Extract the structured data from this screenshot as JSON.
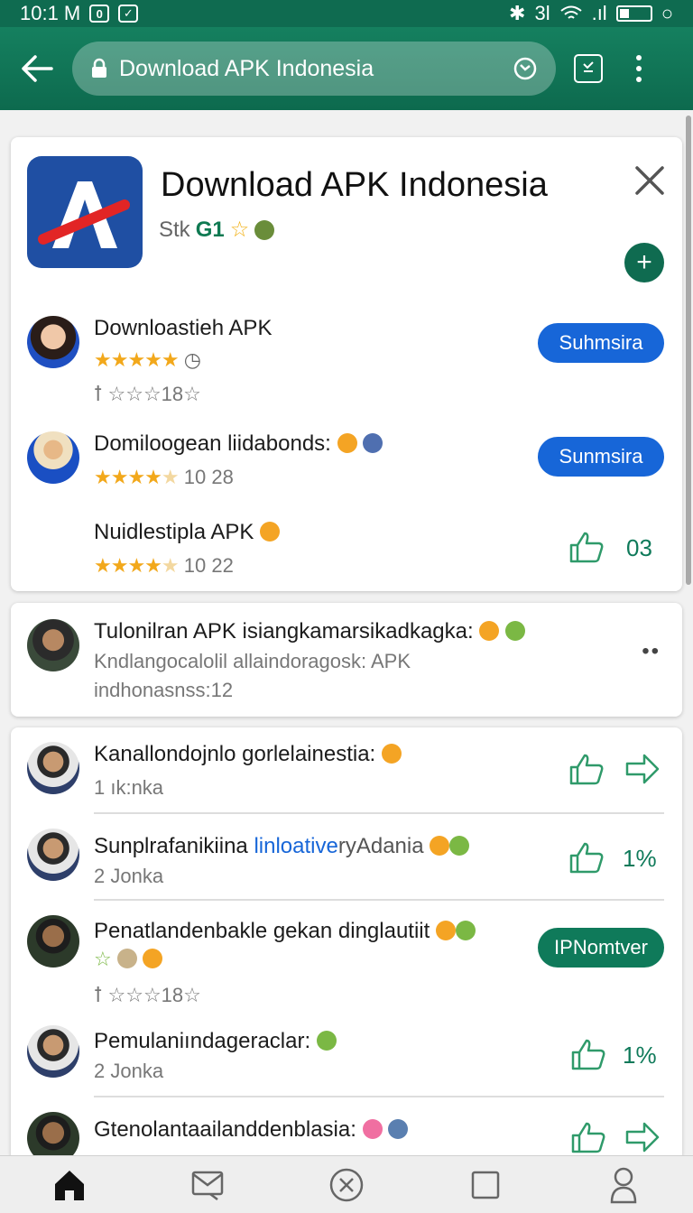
{
  "status_bar": {
    "time": "10:1 M",
    "signal_text": "3l"
  },
  "url_bar": {
    "url_text": "Download APK Indonesia"
  },
  "app_card": {
    "title": "Download APK Indonesia",
    "subtitle_a": "Stk",
    "subtitle_b": "G1",
    "items": [
      {
        "title": "Downloastieh APK",
        "stars": "★★★★★",
        "sub": "ꝉ ☆☆☆18☆",
        "button": "Suhmsira"
      },
      {
        "title": "Domiloogean liidabonds:",
        "stars": "★★★★",
        "rating": "10 28",
        "button": "Sunmsira"
      },
      {
        "title": "Nuidlestipla APK",
        "stars": "★★★★",
        "rating": "10 22",
        "metric": "03"
      }
    ]
  },
  "featured_post": {
    "title": "Tulonilran APK isiangkamarsikadkagka:",
    "line2": "Kndlangocalolil allaindoragosk: APK",
    "line3": "indhonasnss:12",
    "more": "••"
  },
  "feed": [
    {
      "title": "Kanallondojnlo gorlelainestia:",
      "sub": "1 ık:nka"
    },
    {
      "title_a": "Sunplrafanikiina ",
      "title_link": "linloative",
      "title_b": "ryAdania",
      "sub": "2 Jonka",
      "metric": "1%"
    },
    {
      "title": "Penatlandenbakle gekan dinglautiit",
      "sub": "ꝉ ☆☆☆18☆",
      "button": "IPNomtver"
    },
    {
      "title": "Pemulaniındageraclar:",
      "sub": "2 Jonka",
      "metric": "1%"
    },
    {
      "title": "Gtenolantaailanddenblasia:",
      "sub": ""
    }
  ],
  "colors": {
    "primary": "#0f6b50",
    "blue": "#1766d8",
    "star": "#f2a81b"
  }
}
